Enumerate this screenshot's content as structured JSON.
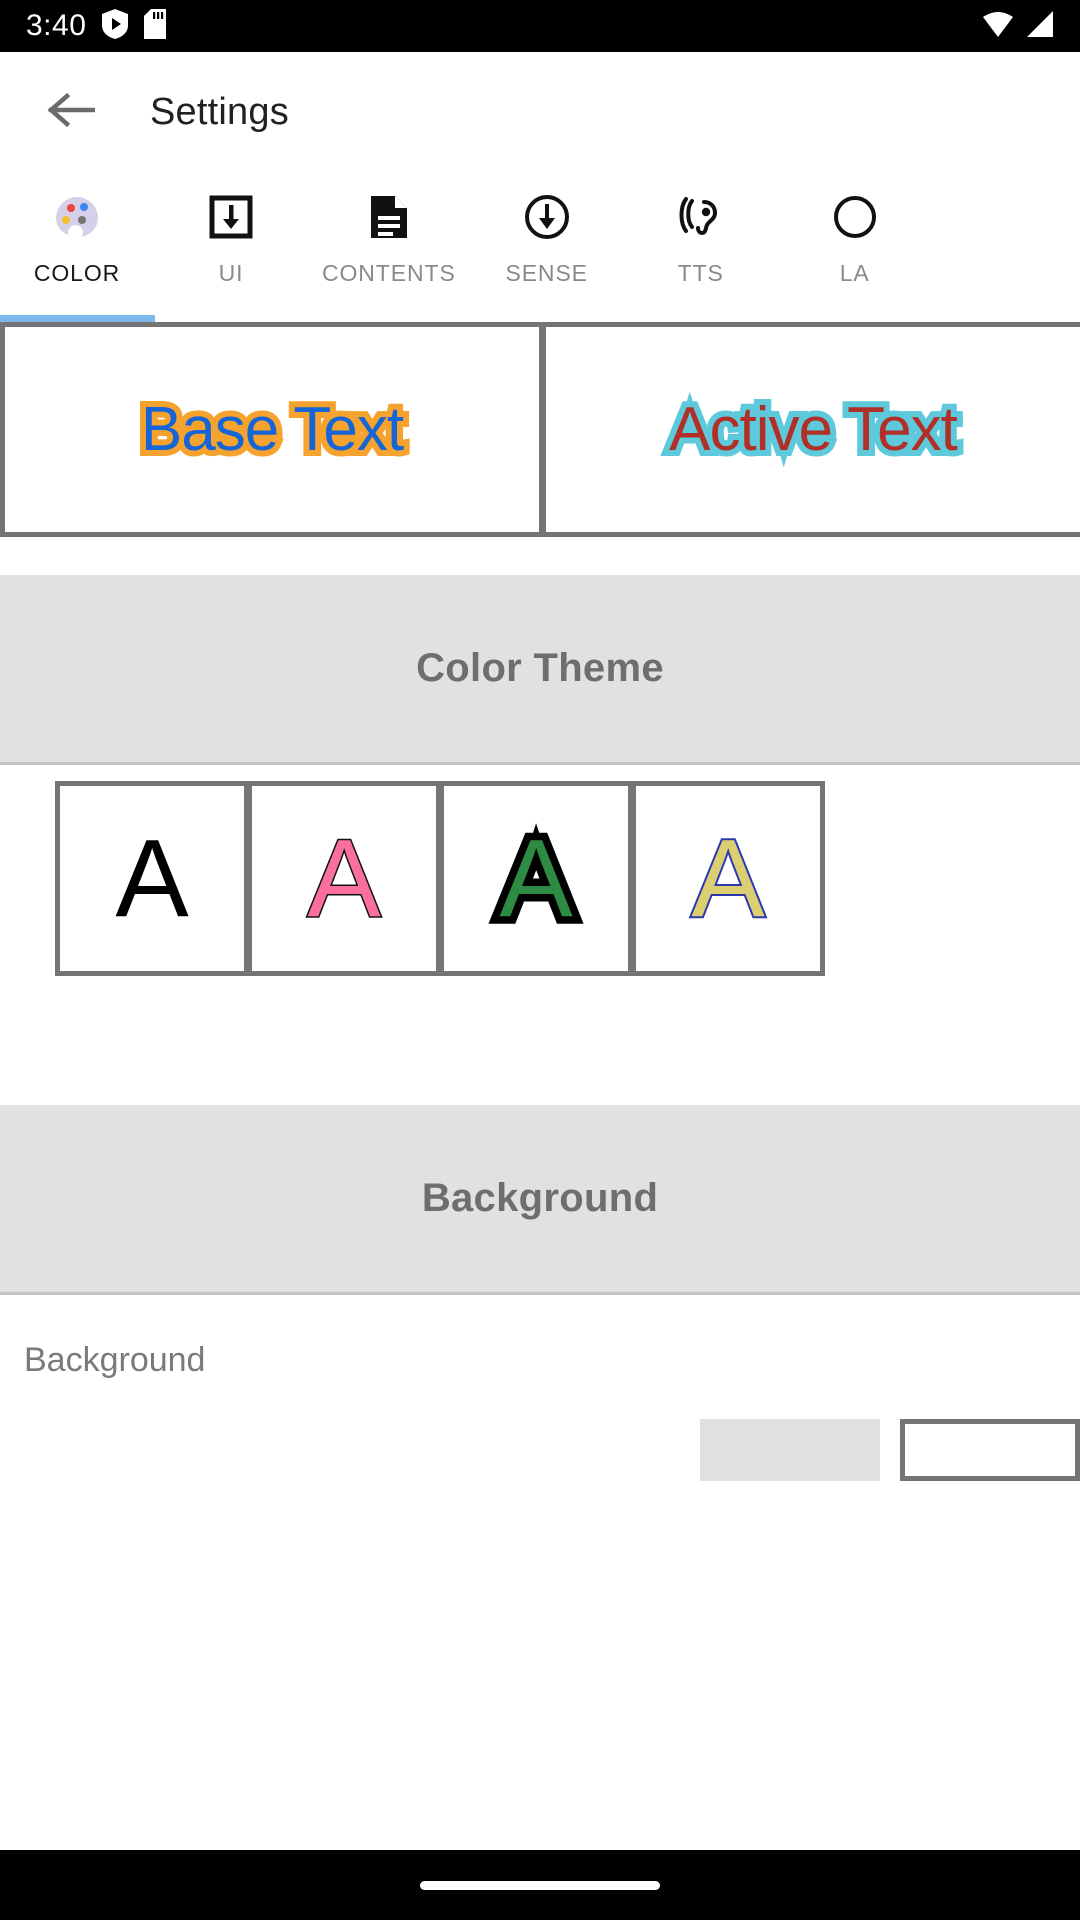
{
  "status_bar": {
    "clock": "3:40",
    "left_icons": [
      "play-shield-icon",
      "sd-card-icon"
    ],
    "right_icons": [
      "wifi-icon",
      "cellular-signal-icon"
    ],
    "background": "#000000"
  },
  "app_bar": {
    "back_icon": "back-arrow-icon",
    "title": "Settings"
  },
  "tabs": {
    "active_index": 0,
    "indicator_color": "#7CB8EA",
    "items": [
      {
        "label": "COLOR",
        "icon": "palette-icon"
      },
      {
        "label": "UI",
        "icon": "download-box-icon"
      },
      {
        "label": "CONTENTS",
        "icon": "document-icon"
      },
      {
        "label": "SENSE",
        "icon": "circle-arrow-down-icon"
      },
      {
        "label": "TTS",
        "icon": "hearing-ear-icon"
      },
      {
        "label": "LA",
        "icon": "language-icon"
      }
    ]
  },
  "preview": {
    "base": {
      "text": "Base Text",
      "fill_color": "#1565D8",
      "outline_color": "#F5A32E"
    },
    "active": {
      "text": "Active Text",
      "fill_color": "#B03028",
      "outline_color": "#5FC9DC"
    }
  },
  "color_theme": {
    "header": "Color Theme",
    "header_bg": "#E1E1E1",
    "header_color": "#6E6E6E",
    "swatches": [
      {
        "glyph": "A",
        "fill_color": "#000000",
        "outline_color": "#000000"
      },
      {
        "glyph": "A",
        "fill_color": "#FA6F9E",
        "outline_color": "#111111"
      },
      {
        "glyph": "A",
        "fill_color": "#2E8B43",
        "outline_color": "#000000"
      },
      {
        "glyph": "A",
        "fill_color": "#DCCF72",
        "outline_color": "#2A3AAD"
      }
    ]
  },
  "background_section": {
    "header": "Background",
    "row_label": "Background",
    "swatches": [
      {
        "name": "grey-swatch",
        "color": "#E0E0E0"
      },
      {
        "name": "white-swatch",
        "color": "#FFFFFF"
      }
    ]
  },
  "nav_bar": {
    "handle": "gesture-home-handle"
  }
}
